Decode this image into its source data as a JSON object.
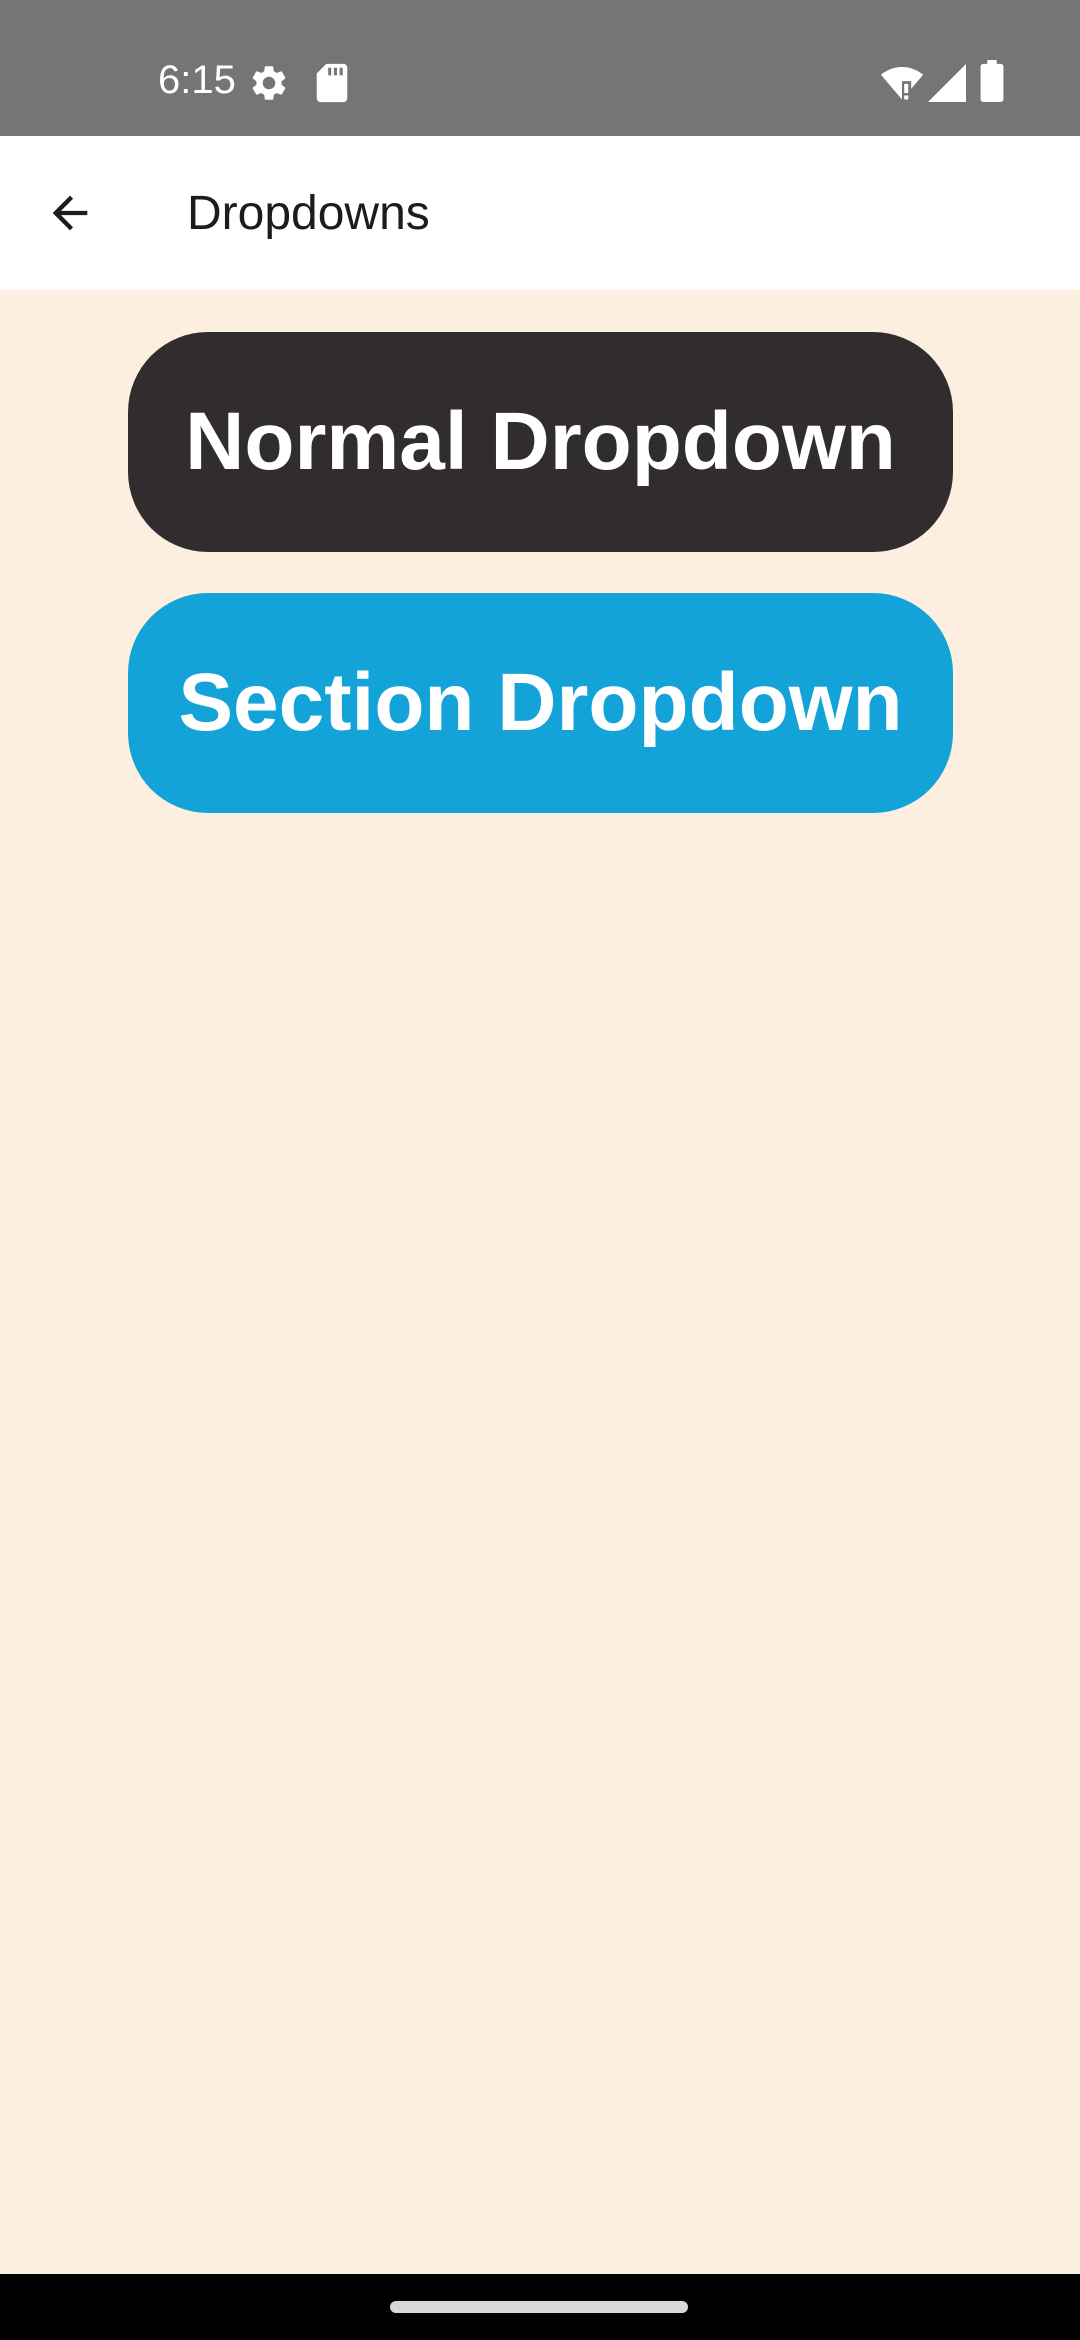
{
  "status_bar": {
    "time": "6:15",
    "icons": [
      "settings-gear-icon",
      "sd-card-icon",
      "wifi-alert-icon",
      "cell-signal-icon",
      "battery-icon"
    ]
  },
  "app_bar": {
    "title": "Dropdowns",
    "back_icon": "arrow-back-icon"
  },
  "buttons": {
    "normal_label": "Normal Dropdown",
    "normal_color": "#312D2F",
    "section_label": "Section Dropdown",
    "section_color": "#13A3D8"
  },
  "colors": {
    "background": "#FCEFE0",
    "status_bar": "#757575",
    "app_bar": "#FFFFFF"
  }
}
